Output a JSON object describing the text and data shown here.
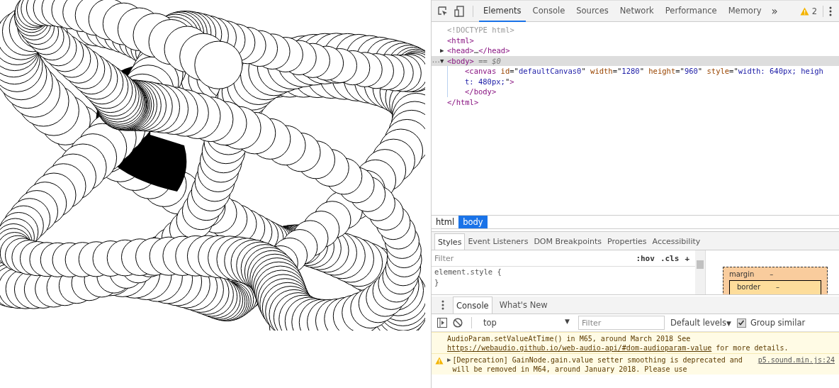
{
  "devtools": {
    "tabs": [
      {
        "label": "Elements",
        "selected": true
      },
      {
        "label": "Console",
        "selected": false
      },
      {
        "label": "Sources",
        "selected": false
      },
      {
        "label": "Network",
        "selected": false
      },
      {
        "label": "Performance",
        "selected": false
      },
      {
        "label": "Memory",
        "selected": false
      }
    ],
    "more_tabs": "»",
    "warning_count": "2",
    "dom_tree": [
      {
        "selected": false,
        "tokens": [
          {
            "kind": "muted",
            "s": "<!DOCTYPE html>"
          }
        ]
      },
      {
        "selected": false,
        "tokens": [
          {
            "kind": "tag",
            "s": "<html>"
          }
        ]
      },
      {
        "toggle": "▶",
        "selected": false,
        "tokens": [
          {
            "kind": "tag",
            "s": "<head>"
          },
          {
            "kind": "plain",
            "s": "…"
          },
          {
            "kind": "tag",
            "s": "</head>"
          }
        ]
      },
      {
        "toggle": "▼",
        "prefix": "...",
        "selected": true,
        "tokens": [
          {
            "kind": "tag",
            "s": "<body>"
          },
          {
            "kind": "note",
            "s": " == $0"
          }
        ],
        "children": [
          {
            "selected": false,
            "tokens": [
              {
                "kind": "tag",
                "s": "<canvas "
              },
              {
                "kind": "attr",
                "s": "id"
              },
              {
                "kind": "plain",
                "s": "=\""
              },
              {
                "kind": "val",
                "s": "defaultCanvas0"
              },
              {
                "kind": "plain",
                "s": "\" "
              },
              {
                "kind": "attr",
                "s": "width"
              },
              {
                "kind": "plain",
                "s": "=\""
              },
              {
                "kind": "val",
                "s": "1280"
              },
              {
                "kind": "plain",
                "s": "\" "
              },
              {
                "kind": "attr",
                "s": "height"
              },
              {
                "kind": "plain",
                "s": "=\""
              },
              {
                "kind": "val",
                "s": "960"
              },
              {
                "kind": "plain",
                "s": "\" "
              },
              {
                "kind": "attr",
                "s": "style"
              },
              {
                "kind": "plain",
                "s": "=\""
              },
              {
                "kind": "val",
                "s": "width: 640px; height: 480px;"
              },
              {
                "kind": "plain",
                "s": "\""
              },
              {
                "kind": "tag",
                "s": ">"
              }
            ]
          },
          {
            "selected": false,
            "tokens": [
              {
                "kind": "tag",
                "s": "</body>"
              }
            ]
          }
        ]
      },
      {
        "selected": false,
        "tokens": [
          {
            "kind": "tag",
            "s": "</html>"
          }
        ]
      }
    ],
    "breadcrumbs": [
      {
        "label": "html",
        "selected": false
      },
      {
        "label": "body",
        "selected": true
      }
    ],
    "sidebar_tabs": [
      {
        "label": "Styles",
        "selected": true
      },
      {
        "label": "Event Listeners",
        "selected": false
      },
      {
        "label": "DOM Breakpoints",
        "selected": false
      },
      {
        "label": "Properties",
        "selected": false
      },
      {
        "label": "Accessibility",
        "selected": false
      }
    ],
    "styles_filter": {
      "placeholder": "Filter"
    },
    "styles_buttons": [
      ":hov",
      ".cls",
      "+"
    ],
    "style_rule": [
      "element.style {",
      "}"
    ],
    "box_model": [
      {
        "label": "margin",
        "value": "–"
      },
      {
        "label": "border",
        "value": "–"
      }
    ],
    "drawer_tabs": [
      {
        "label": "Console",
        "selected": true
      },
      {
        "label": "What's New",
        "selected": false
      }
    ],
    "console_toolbar": {
      "context": "top",
      "context_caret": "▼",
      "levels_caret": "▼",
      "filter": {
        "placeholder": "Filter"
      },
      "levels": "Default levels",
      "group_similar": {
        "label": "Group similar",
        "checked": true
      }
    },
    "messages": [
      {
        "kind": "warning",
        "icon": false,
        "text": "AudioParam.setValueAtTime() in M65, around March 2018  See ",
        "link": "https://webaudio.github.io/web-audio-api/#dom-audioparam-value",
        "after": " for more details."
      },
      {
        "kind": "warning",
        "icon": true,
        "toggle": "▶",
        "text": "[Deprecation] GainNode.gain.value setter smoothing is deprecated and will be removed in M64, around January 2018. Please use",
        "source": "p5.sound.min.js:24"
      }
    ]
  }
}
